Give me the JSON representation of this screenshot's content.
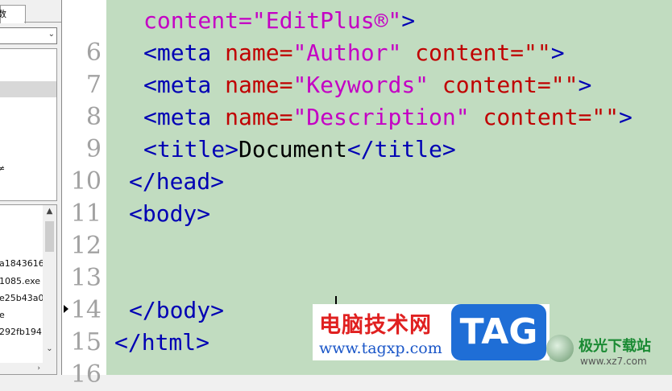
{
  "sidebar": {
    "tab_label": "数",
    "directory_fragment": "≠",
    "files": [
      "a1843616",
      "1085.exe",
      "e25b43a0",
      "e",
      "292fb194"
    ]
  },
  "editor": {
    "line_numbers": [
      "6",
      "7",
      "8",
      "9",
      "10",
      "11",
      "12",
      "13",
      "14",
      "15",
      "16"
    ],
    "code": {
      "l5": {
        "val": "content=\"EditPlus®\"",
        "tag": ">"
      },
      "l6": {
        "tag_open": "<meta",
        "attr": "name=",
        "val1": "\"Author\"",
        "val2": "content=\"\"",
        "tag_close": ">"
      },
      "l7": {
        "tag_open": "<meta",
        "attr": "name=",
        "val1": "\"Keywords\"",
        "val2": "content=\"\"",
        "tag_close": ">"
      },
      "l8": {
        "tag_open": "<meta",
        "attr": "name=",
        "val1": "\"Description\"",
        "val2": "content=\"\"",
        "tag_close": ">"
      },
      "l9": {
        "tag_open": "<title>",
        "text": "Document",
        "tag_close": "</title>"
      },
      "l10": "</head>",
      "l11": "<body>",
      "l14": "</body>",
      "l15": "</html>"
    }
  },
  "watermarks": {
    "site_cn": "电脑技术网",
    "site_url": "www.tagxp.com",
    "badge": "TAG",
    "site2_cn": "极光下载站",
    "site2_url": "www.xz7.com"
  },
  "colors": {
    "editor_bg": "#c1dcc0",
    "tag": "#0000b4",
    "attr": "#c00000",
    "value": "#c400c4",
    "line_number": "#a2a2a2"
  }
}
